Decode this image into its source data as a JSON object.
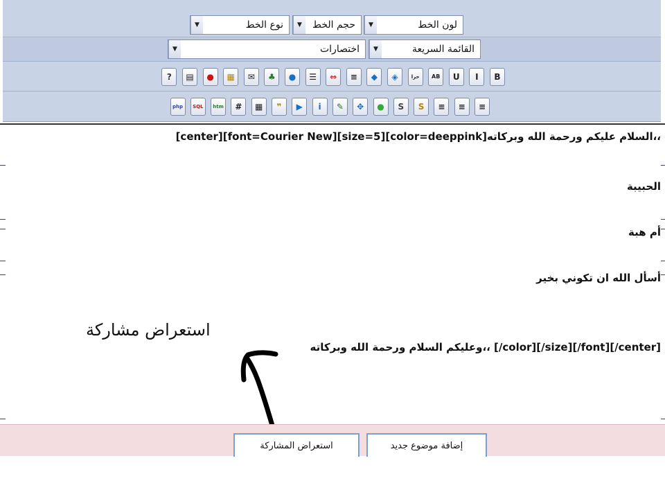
{
  "toolbar": {
    "font_color_label": "لون الخط",
    "font_size_label": "حجم الخط",
    "font_type_label": "نوع الخط",
    "quick_list_label": "القائمة السريعة",
    "shortcuts_label": "اختصارات",
    "format_buttons": [
      {
        "icon": "bold-icon",
        "glyph": "B"
      },
      {
        "icon": "italic-icon",
        "glyph": "I"
      },
      {
        "icon": "underline-icon",
        "glyph": "U"
      },
      {
        "icon": "strikethrough-icon",
        "glyph": "AB"
      },
      {
        "icon": "text-direction-icon",
        "glyph": "حرا"
      },
      {
        "icon": "blue-drop-icon",
        "glyph": "◈"
      },
      {
        "icon": "shield-icon",
        "glyph": "◆"
      },
      {
        "icon": "indent-icon",
        "glyph": "≡"
      },
      {
        "icon": "move-arrows-icon",
        "glyph": "⇔"
      },
      {
        "icon": "list-icon",
        "glyph": "☰"
      },
      {
        "icon": "water-drop-icon",
        "glyph": "●"
      },
      {
        "icon": "people-icon",
        "glyph": "♣"
      },
      {
        "icon": "email-icon",
        "glyph": "✉"
      },
      {
        "icon": "image-icon",
        "glyph": "▦"
      },
      {
        "icon": "flash-icon",
        "glyph": "●"
      },
      {
        "icon": "document-icon",
        "glyph": "▤"
      },
      {
        "icon": "help-icon",
        "glyph": "?"
      }
    ],
    "align_buttons": [
      {
        "icon": "align-right-icon",
        "glyph": "≡"
      },
      {
        "icon": "align-center-icon",
        "glyph": "≡"
      },
      {
        "icon": "align-left-icon",
        "glyph": "≡"
      },
      {
        "icon": "gold-s-icon",
        "glyph": "S"
      },
      {
        "icon": "gray-s-icon",
        "glyph": "S"
      },
      {
        "icon": "green-ball-icon",
        "glyph": "●"
      },
      {
        "icon": "expand-icon",
        "glyph": "✥"
      },
      {
        "icon": "pencil-icon",
        "glyph": "✎"
      },
      {
        "icon": "info-icon",
        "glyph": "i"
      },
      {
        "icon": "media-player-icon",
        "glyph": "▶"
      },
      {
        "icon": "quote-icon",
        "glyph": "❞"
      },
      {
        "icon": "table-icon",
        "glyph": "▦"
      },
      {
        "icon": "hash-icon",
        "glyph": "#"
      },
      {
        "icon": "html-icon",
        "glyph": "htm"
      },
      {
        "icon": "sql-icon",
        "glyph": "SQL"
      },
      {
        "icon": "php-icon",
        "glyph": "php"
      }
    ]
  },
  "editor": {
    "line1": "[center][font=Courier New][size=5][color=deeppink]السلام عليكم ورحمة الله وبركاته،،",
    "line2": "الحبيبة",
    "line3": "أم هبة",
    "line4": "أسأل الله ان تكوني بخير",
    "line5": "وعليكم السلام ورحمة الله وبركاته،، [/color][/size][/font][/center]"
  },
  "annotation": {
    "text": "استعراض مشاركة"
  },
  "bottom": {
    "preview_label": "استعراض المشاركة",
    "new_topic_label": "إضافة موضوع جديد"
  }
}
